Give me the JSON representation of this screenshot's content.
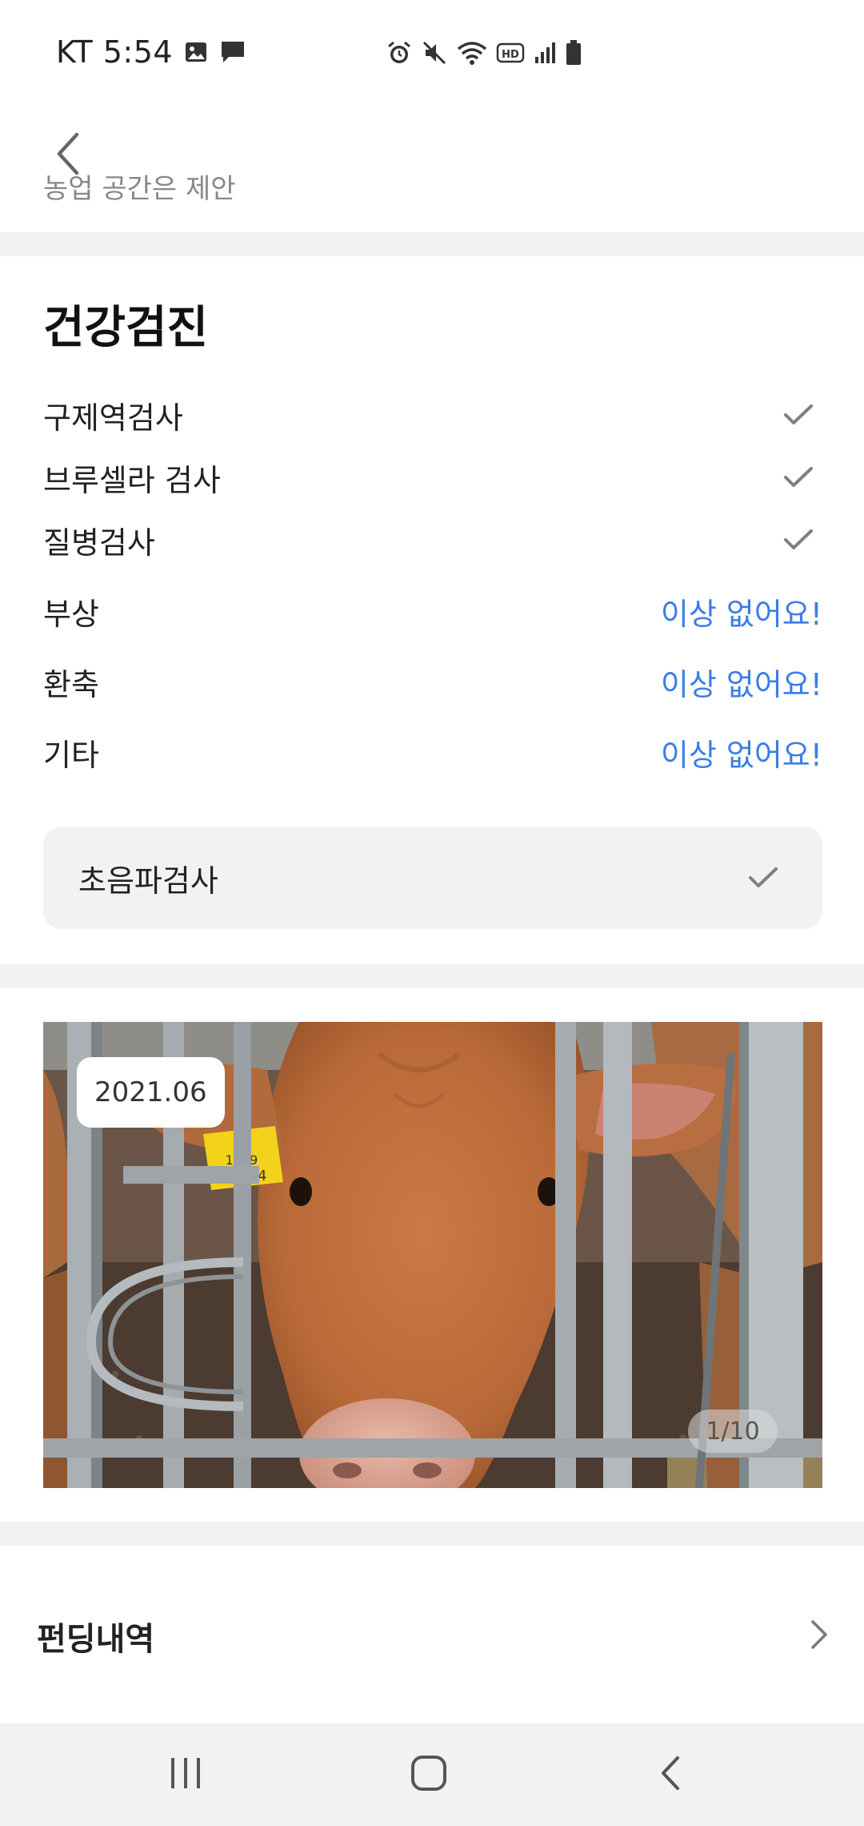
{
  "status_bar": {
    "carrier_time": "KT 5:54",
    "left_icons": [
      "image-icon",
      "message-icon"
    ],
    "right_icons": [
      "alarm-icon",
      "mute-icon",
      "wifi-icon",
      "hd-icon",
      "signal-icon",
      "battery-icon"
    ],
    "hd_label": "HD"
  },
  "app_bar": {
    "back_icon": "chevron-left-icon",
    "clipped_text": "농업 공간은 제안"
  },
  "health": {
    "title": "건강검진",
    "check_items": [
      {
        "label": "구제역검사",
        "icon": "check-icon"
      },
      {
        "label": "브루셀라 검사",
        "icon": "check-icon"
      },
      {
        "label": "질병검사",
        "icon": "check-icon"
      }
    ],
    "status_items": [
      {
        "label": "부상",
        "status": "이상 없어요!"
      },
      {
        "label": "환축",
        "status": "이상 없어요!"
      },
      {
        "label": "기타",
        "status": "이상 없어요!"
      }
    ],
    "ultrasound": {
      "label": "초음파검사",
      "icon": "check-icon"
    }
  },
  "photo": {
    "date": "2021.06",
    "counter": "1/10",
    "ear_tag_line1": "1579",
    "ear_tag_line2": "8470 4"
  },
  "funding": {
    "title": "펀딩내역",
    "icon": "chevron-right-icon"
  },
  "nav_bar": {
    "buttons": [
      "recent-apps-icon",
      "home-icon",
      "back-icon"
    ]
  },
  "colors": {
    "accent_blue": "#3c7ee6",
    "divider_gray": "#f2f2f2",
    "check_gray": "#808080"
  }
}
